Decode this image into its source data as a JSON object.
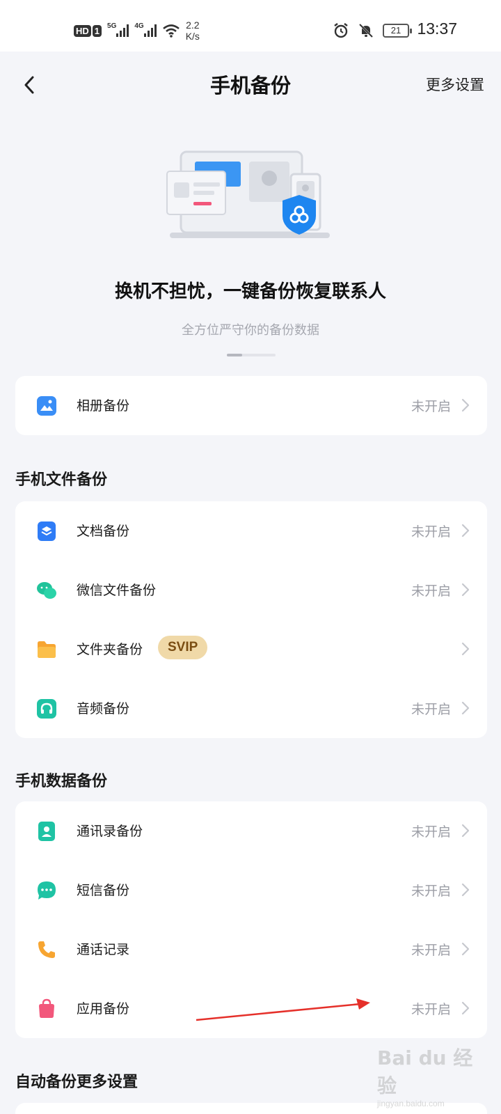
{
  "status_bar": {
    "hd": "HD",
    "sim": "1",
    "net1": "5G",
    "net2": "4G",
    "speed_value": "2.2",
    "speed_unit": "K/s",
    "battery": "21",
    "time": "13:37"
  },
  "nav": {
    "title": "手机备份",
    "more": "更多设置"
  },
  "hero": {
    "title": "换机不担忧，一键备份恢复联系人",
    "subtitle": "全方位严守你的备份数据"
  },
  "album": {
    "label": "相册备份",
    "status": "未开启",
    "icon": "album-icon",
    "color": "#3a8ef6"
  },
  "file_section": {
    "title": "手机文件备份",
    "items": [
      {
        "label": "文档备份",
        "status": "未开启",
        "icon": "document-icon",
        "color": "#2f7cf6"
      },
      {
        "label": "微信文件备份",
        "status": "未开启",
        "icon": "wechat-icon",
        "color": "#21c39a"
      },
      {
        "label": "文件夹备份",
        "status": "",
        "badge": "SVIP",
        "icon": "folder-icon",
        "color": "#f7a531"
      },
      {
        "label": "音频备份",
        "status": "未开启",
        "icon": "headphones-icon",
        "color": "#1fc3a4"
      }
    ]
  },
  "data_section": {
    "title": "手机数据备份",
    "items": [
      {
        "label": "通讯录备份",
        "status": "未开启",
        "icon": "contacts-icon",
        "color": "#1fc3a4"
      },
      {
        "label": "短信备份",
        "status": "未开启",
        "icon": "sms-icon",
        "color": "#1fc3a4"
      },
      {
        "label": "通话记录",
        "status": "未开启",
        "icon": "phone-icon",
        "color": "#f7a531"
      },
      {
        "label": "应用备份",
        "status": "未开启",
        "icon": "app-bag-icon",
        "color": "#f2577b"
      }
    ]
  },
  "auto_section": {
    "title": "自动备份更多设置"
  },
  "watermark": {
    "text": "Bai du 经验",
    "url": "jingyan.baidu.com"
  }
}
